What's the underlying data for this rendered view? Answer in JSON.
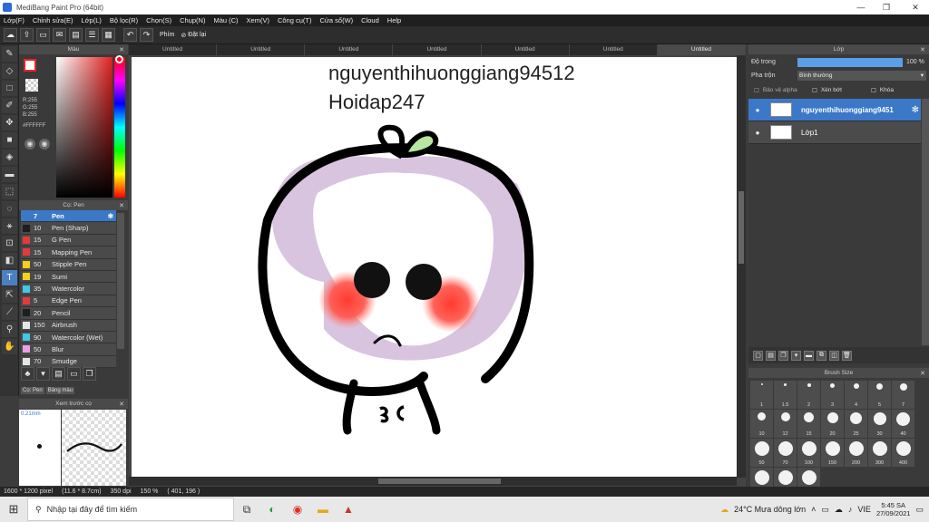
{
  "window": {
    "title": "MediBang Paint Pro (64bit)",
    "min_glyph": "—",
    "max_glyph": "❐",
    "close_glyph": "✕"
  },
  "menu": [
    "Lớp(F)",
    "Chỉnh sửa(E)",
    "Lớp(L)",
    "Bộ lọc(R)",
    "Chọn(S)",
    "Chụp(N)",
    "Màu (C)",
    "Xem(V)",
    "Công cụ(T)",
    "Cửa sổ(W)",
    "Cloud",
    "Help"
  ],
  "toolbar": {
    "phim_label": "Phím",
    "reset_label": "Đặt lại"
  },
  "color_panel": {
    "title": "Màu",
    "rgb": [
      "R:255",
      "G:255",
      "B:255"
    ],
    "hex": "#FFFFFF"
  },
  "brush_panel": {
    "title": "Cọ: Pen",
    "items": [
      {
        "size": "7",
        "name": "Pen",
        "color": "#3b78c8"
      },
      {
        "size": "10",
        "name": "Pen (Sharp)",
        "color": "#1e1e1e"
      },
      {
        "size": "15",
        "name": "G Pen",
        "color": "#e33b3b"
      },
      {
        "size": "15",
        "name": "Mapping Pen",
        "color": "#e33b3b"
      },
      {
        "size": "50",
        "name": "Stipple Pen",
        "color": "#f2d21a"
      },
      {
        "size": "19",
        "name": "Sumi",
        "color": "#f2d21a"
      },
      {
        "size": "35",
        "name": "Watercolor",
        "color": "#41c7e8"
      },
      {
        "size": "5",
        "name": "Edge Pen",
        "color": "#e33b3b"
      },
      {
        "size": "20",
        "name": "Pencil",
        "color": "#1e1e1e"
      },
      {
        "size": "150",
        "name": "Airbrush",
        "color": "#e6e6e6"
      },
      {
        "size": "90",
        "name": "Watercolor (Wet)",
        "color": "#41c7e8"
      },
      {
        "size": "50",
        "name": "Blur",
        "color": "#e7a0e6"
      },
      {
        "size": "70",
        "name": "Smudge",
        "color": "#e6e6e6"
      }
    ],
    "tabs": [
      "Cọ: Pen",
      "Bảng màu"
    ]
  },
  "preview_panel": {
    "title": "Xem trước cọ",
    "size_label": "0.21mm"
  },
  "doc_tabs": [
    "Untitled",
    "Untitled",
    "Untitled",
    "Untitled",
    "Untitled",
    "Untitled",
    "Untitled"
  ],
  "canvas": {
    "text_line1": "nguyenthihuonggiang94512",
    "text_line2": "Hoidap247"
  },
  "layer_panel": {
    "title": "Lớp",
    "opacity_label": "Độ trong",
    "opacity_value": "100 %",
    "opacity_fraction": 1.0,
    "blend_label": "Pha trộn",
    "blend_value": "Bình thường",
    "protect_alpha": "Bảo vệ alpha",
    "clipping": "Xén bớt",
    "lock": "Khóa",
    "layers": [
      {
        "name": "nguyenthihuonggiang9451",
        "selected": true
      },
      {
        "name": "Lớp1",
        "selected": false
      }
    ]
  },
  "size_panel": {
    "title": "Brush Size",
    "sizes": [
      "1",
      "1.5",
      "2",
      "3",
      "4",
      "5",
      "7",
      "10",
      "12",
      "15",
      "20",
      "25",
      "30",
      "40",
      "50",
      "70",
      "100",
      "150",
      "200",
      "300",
      "400",
      "",
      "",
      ""
    ]
  },
  "status": {
    "dimensions": "1600 * 1200 pixel",
    "physical": "(11.6 * 8.7cm)",
    "dpi": "350 dpi",
    "zoom": "150 %",
    "cursor": "( 401, 196 )"
  },
  "taskbar": {
    "search_placeholder": "Nhập tại đây để tìm kiếm",
    "weather": "24°C  Mưa dông lớn",
    "lang": "VIE",
    "time": "5:45 SA",
    "date": "27/09/2021"
  }
}
